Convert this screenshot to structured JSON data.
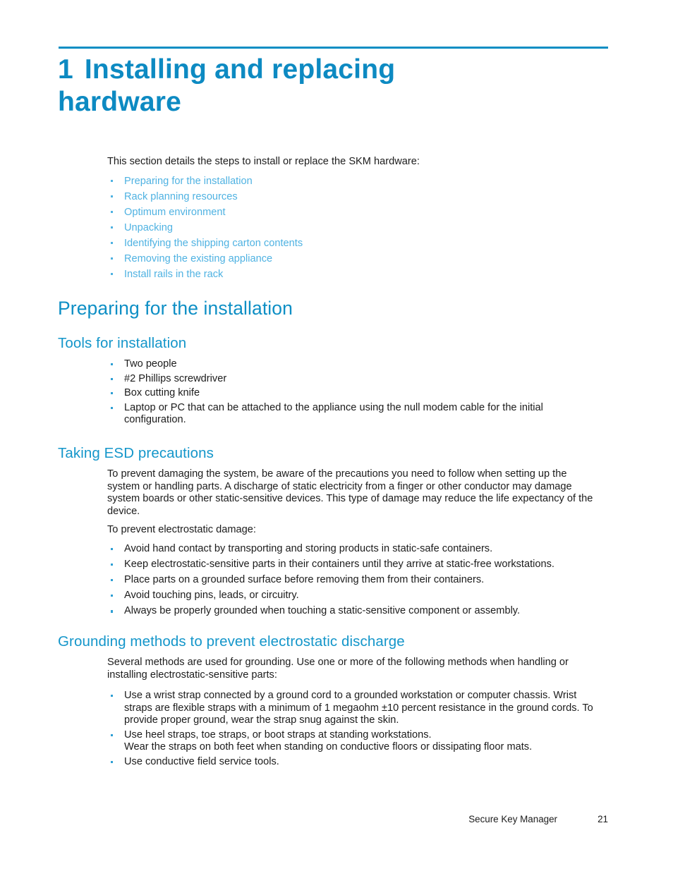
{
  "chapter": {
    "number": "1",
    "title": "Installing and replacing hardware",
    "rule_color": "#0b8ec4",
    "title_color": "#0d8ac2"
  },
  "intro": {
    "text": "This section details the steps to install or replace the SKM hardware:"
  },
  "toc_links": [
    {
      "label": "Preparing for the installation"
    },
    {
      "label": "Rack planning resources"
    },
    {
      "label": "Optimum environment"
    },
    {
      "label": "Unpacking"
    },
    {
      "label": "Identifying the shipping carton contents"
    },
    {
      "label": "Removing the existing appliance"
    },
    {
      "label": "Install rails in the rack"
    }
  ],
  "link_color": "#4fb2e2",
  "sections": {
    "preparing": {
      "heading": "Preparing for the installation"
    },
    "tools": {
      "heading": "Tools for installation",
      "items": [
        "Two people",
        "#2 Phillips screwdriver",
        "Box cutting knife",
        "Laptop or PC that can be attached to the appliance using the null modem cable for the initial configuration."
      ]
    },
    "esd": {
      "heading": "Taking ESD precautions",
      "paragraph_1": "To prevent damaging the system, be aware of the precautions you need to follow when setting up the system or handling parts.  A discharge of static electricity from a finger or other conductor may damage system boards or other static-sensitive devices.  This type of damage may reduce the life expectancy of the device.",
      "paragraph_2": "To prevent electrostatic damage:",
      "items": [
        "Avoid hand contact by transporting and storing products in static-safe containers.",
        "Keep electrostatic-sensitive parts in their containers until they arrive at static-free workstations.",
        "Place parts on a grounded surface before removing them from their containers.",
        "Avoid touching pins, leads, or circuitry.",
        "Always be properly grounded when touching a static-sensitive component or assembly."
      ]
    },
    "grounding": {
      "heading": "Grounding methods to prevent electrostatic discharge",
      "paragraph_1": "Several methods are used for grounding.  Use one or more of the following methods when handling or installing electrostatic-sensitive parts:",
      "items": [
        "Use a wrist strap connected by a ground cord to a grounded workstation or computer chassis. Wrist straps are flexible straps with a minimum of 1 megaohm ±10 percent resistance in the ground cords.  To provide proper ground, wear the strap snug against the skin.",
        "Use heel straps, toe straps, or boot straps at standing workstations.\nWear the straps on both feet when standing on conductive floors or dissipating floor mats.",
        "Use conductive field service tools."
      ]
    }
  },
  "footer": {
    "document_title": "Secure Key Manager",
    "page_number": "21"
  },
  "heading_color": "#0e8fc5",
  "subheading_color": "#1496ca"
}
